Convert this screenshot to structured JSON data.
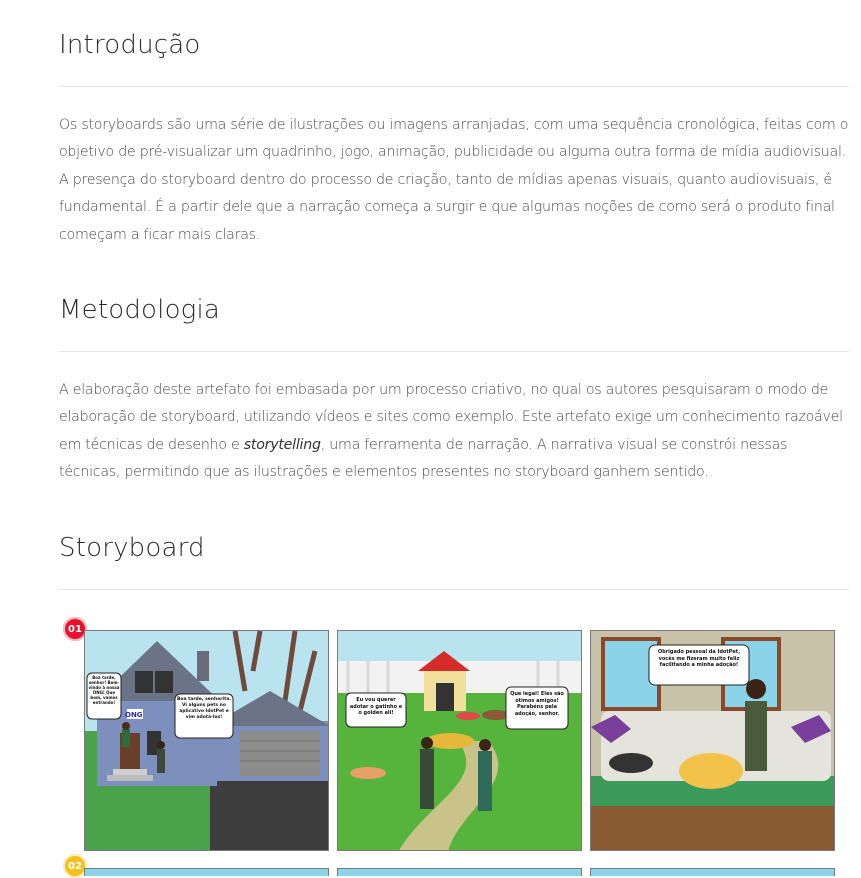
{
  "sections": [
    {
      "title": "Introdução",
      "paragraph": "Os storyboards são uma série de ilustrações ou imagens arranjadas, com uma sequência cronológica, feitas com o objetivo de pré-visualizar um quadrinho, jogo, animação, publicidade ou alguma outra forma de mídia audiovisual. A presença do storyboard dentro do processo de criação, tanto de mídias apenas visuais, quanto audiovisuais, é fundamental. É a partir dele que a narração começa a surgir e que algumas noções de como será o produto final começam a ficar mais claras."
    },
    {
      "title": "Metodologia",
      "paragraph_before": "A elaboração deste artefato foi embasada por um processo criativo, no qual os autores pesquisaram o modo de elaboração de storyboard, utilizando vídeos e sites como exemplo. Este artefato exige um conhecimento razoável em técnicas de desenho e ",
      "paragraph_em": "storytelling",
      "paragraph_after": ", uma ferramenta de narração. A narrativa visual se constrói nessas técnicas, permitindo que as ilustrações e elementos presentes no storyboard ganhem sentido."
    },
    {
      "title": "Storyboard"
    }
  ],
  "storyboard": {
    "rows": [
      {
        "badge": "01",
        "badge_color": "#e8112d"
      },
      {
        "badge": "02",
        "badge_color": "#f2c21b"
      }
    ],
    "panels": [
      {
        "sign": "ONG",
        "bubble_left": "Boa tarde, senhor! Bem-vindo à nossa ONG! Que bom, vamos entrando!",
        "bubble_right": "Boa tarde, senhorita. Vi alguns pets no aplicativo IdotPet e vim adotá-los!"
      },
      {
        "bubble_left": "Eu vou querer adotar o gatinho e o golden ali!",
        "bubble_right": "Que legal! Eles são ótimos amigos! Parabéns pela adoção, senhor."
      },
      {
        "bubble": "Obrigado pessoal da IdotPet, vocês me fizeram muito feliz facilitando a minha adoção!"
      }
    ]
  }
}
